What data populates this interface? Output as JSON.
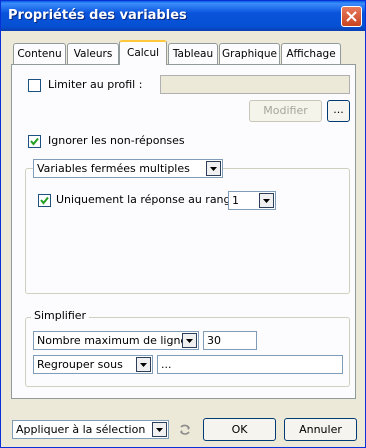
{
  "window": {
    "title": "Propriétés des variables"
  },
  "tabs": [
    {
      "label": "Contenu"
    },
    {
      "label": "Valeurs"
    },
    {
      "label": "Calcul",
      "active": true
    },
    {
      "label": "Tableau"
    },
    {
      "label": "Graphique"
    },
    {
      "label": "Affichage"
    }
  ],
  "calcul": {
    "limiter": {
      "label": "Limiter au profil :",
      "checked": false,
      "value": ""
    },
    "modifier_button": "Modifier",
    "browse_button": "...",
    "ignorer": {
      "label": "Ignorer les non-réponses",
      "checked": true
    },
    "variables_combo": {
      "value": "Variables fermées multiples"
    },
    "uniquement": {
      "label": "Uniquement la réponse au rang",
      "checked": true,
      "rang": "1"
    },
    "simplifier": {
      "title": "Simplifier",
      "max_lines_combo": "Nombre maximum de lignes",
      "max_lines_value": "30",
      "regrouper_combo": "Regrouper sous",
      "regrouper_value": "..."
    }
  },
  "footer": {
    "apply_combo": "Appliquer à la sélection",
    "ok_button": "OK",
    "cancel_button": "Annuler"
  },
  "colors": {
    "titlebar": "#0a54dc",
    "dialog_bg": "#ece9d8",
    "panel_bg": "#fcfcfe",
    "active_tab_highlight": "#ffc83c"
  }
}
